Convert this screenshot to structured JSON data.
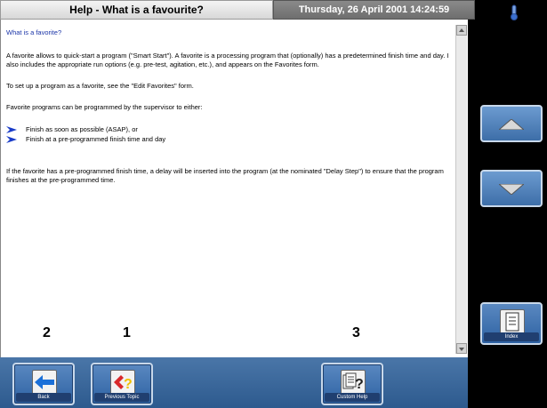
{
  "title": "Help - What is a favourite?",
  "datetime": "Thursday, 26 April 2001 14:24:59",
  "content": {
    "heading": "What is a favorite?",
    "paragraphs": [
      "A favorite allows to quick-start a program (\"Smart Start\"). A favorite is a processing program that (optionally) has a predetermined finish time and day. I also includes the appropriate run options (e.g. pre-test, agitation, etc.), and appears on the Favorites form.",
      "To set up a program as a favorite, see the \"Edit Favorites\" form.",
      "Favorite programs can be programmed by the supervisor to either:"
    ],
    "bullets": [
      "Finish as soon as possible (ASAP), or",
      "Finish at a pre-programmed finish time and day"
    ],
    "closing": "If the favorite has a pre-programmed finish time, a delay will be inserted into the program (at the nominated \"Delay Step\") to ensure that the program finishes at the pre-programmed time."
  },
  "annotations": [
    "2",
    "1",
    "3"
  ],
  "toolbar": {
    "back_label": "Back",
    "previous_topic_label": "Previous Topic",
    "custom_help_label": "Custom Help"
  },
  "sidebar": {
    "index_label": "Index"
  },
  "colors": {
    "toolbar": "#3a6699",
    "heading": "#1a34a8",
    "back_arrow": "#1a6fd8",
    "previous_topic_arrow": "#d8282a",
    "previous_topic_question": "#f0c000"
  },
  "icons": {
    "back": "back-arrow-icon",
    "previous_topic": "previous-topic-icon",
    "custom_help": "custom-help-icon",
    "scroll_up": "scroll-up-icon",
    "scroll_down": "scroll-down-icon",
    "index": "index-icon",
    "status": "thermometer-icon"
  }
}
